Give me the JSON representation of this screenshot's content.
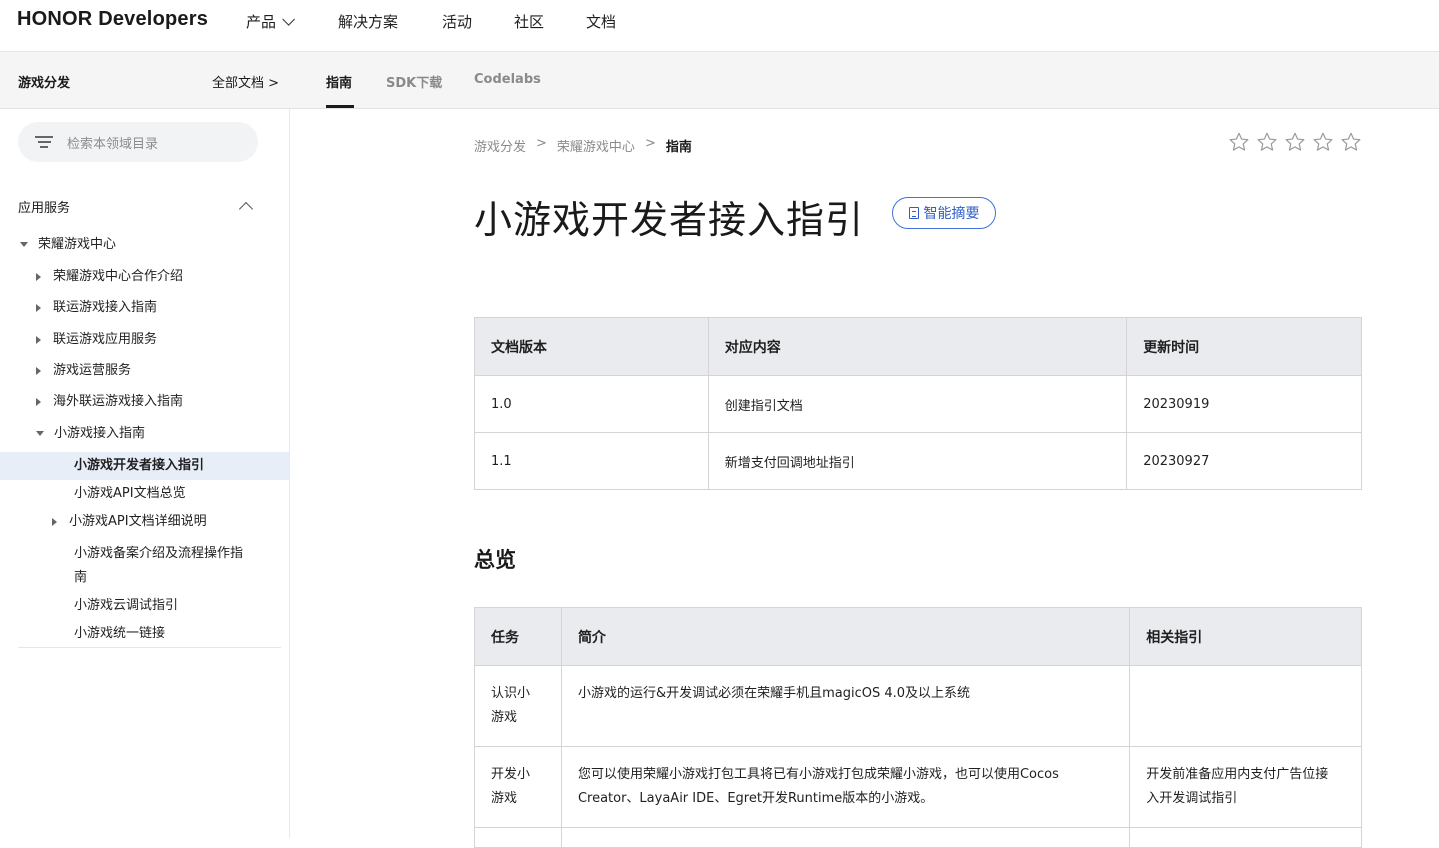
{
  "header": {
    "logo": "HONOR Developers",
    "nav": [
      "产品",
      "解决方案",
      "活动",
      "社区",
      "文档"
    ]
  },
  "subnav": {
    "section": "游戏分发",
    "all_docs": "全部文档 >",
    "tabs": [
      "指南",
      "SDK下载",
      "Codelabs"
    ]
  },
  "sidebar": {
    "search_placeholder": "检索本领域目录",
    "group": "应用服务",
    "tree": [
      "荣耀游戏中心",
      "荣耀游戏中心合作介绍",
      "联运游戏接入指南",
      "联运游戏应用服务",
      "游戏运营服务",
      "海外联运游戏接入指南",
      "小游戏接入指南",
      "小游戏开发者接入指引",
      "小游戏API文档总览",
      "小游戏API文档详细说明",
      "小游戏备案介绍及流程操作指",
      "南",
      "小游戏云调试指引",
      "小游戏统一链接"
    ]
  },
  "breadcrumb": [
    "游戏分发",
    "荣耀游戏中心",
    "指南"
  ],
  "breadcrumb_sep": ">",
  "page": {
    "title": "小游戏开发者接入指引",
    "ai_summary": "智能摘要",
    "section_overview": "总览"
  },
  "version_table": {
    "headers": [
      "文档版本",
      "对应内容",
      "更新时间"
    ],
    "rows": [
      [
        "1.0",
        "创建指引文档",
        "20230919"
      ],
      [
        "1.1",
        "新增支付回调地址指引",
        "20230927"
      ]
    ]
  },
  "overview_table": {
    "headers": [
      "任务",
      "简介",
      "相关指引"
    ],
    "rows": [
      [
        "认识小",
        "游戏",
        "小游戏的运行&开发调试必须在荣耀手机且magicOS 4.0及以上系统",
        ""
      ],
      [
        "开发小",
        "游戏",
        "您可以使用荣耀小游戏打包工具将已有小游戏打包成荣耀小游戏，也可以使用Cocos",
        "Creator、LayaAir IDE、Egret开发Runtime版本的小游戏。",
        "开发前准备应用内支付广告位接",
        "入开发调试指引"
      ]
    ]
  },
  "rating": {
    "stars_filled": 0,
    "stars_total": 5
  }
}
